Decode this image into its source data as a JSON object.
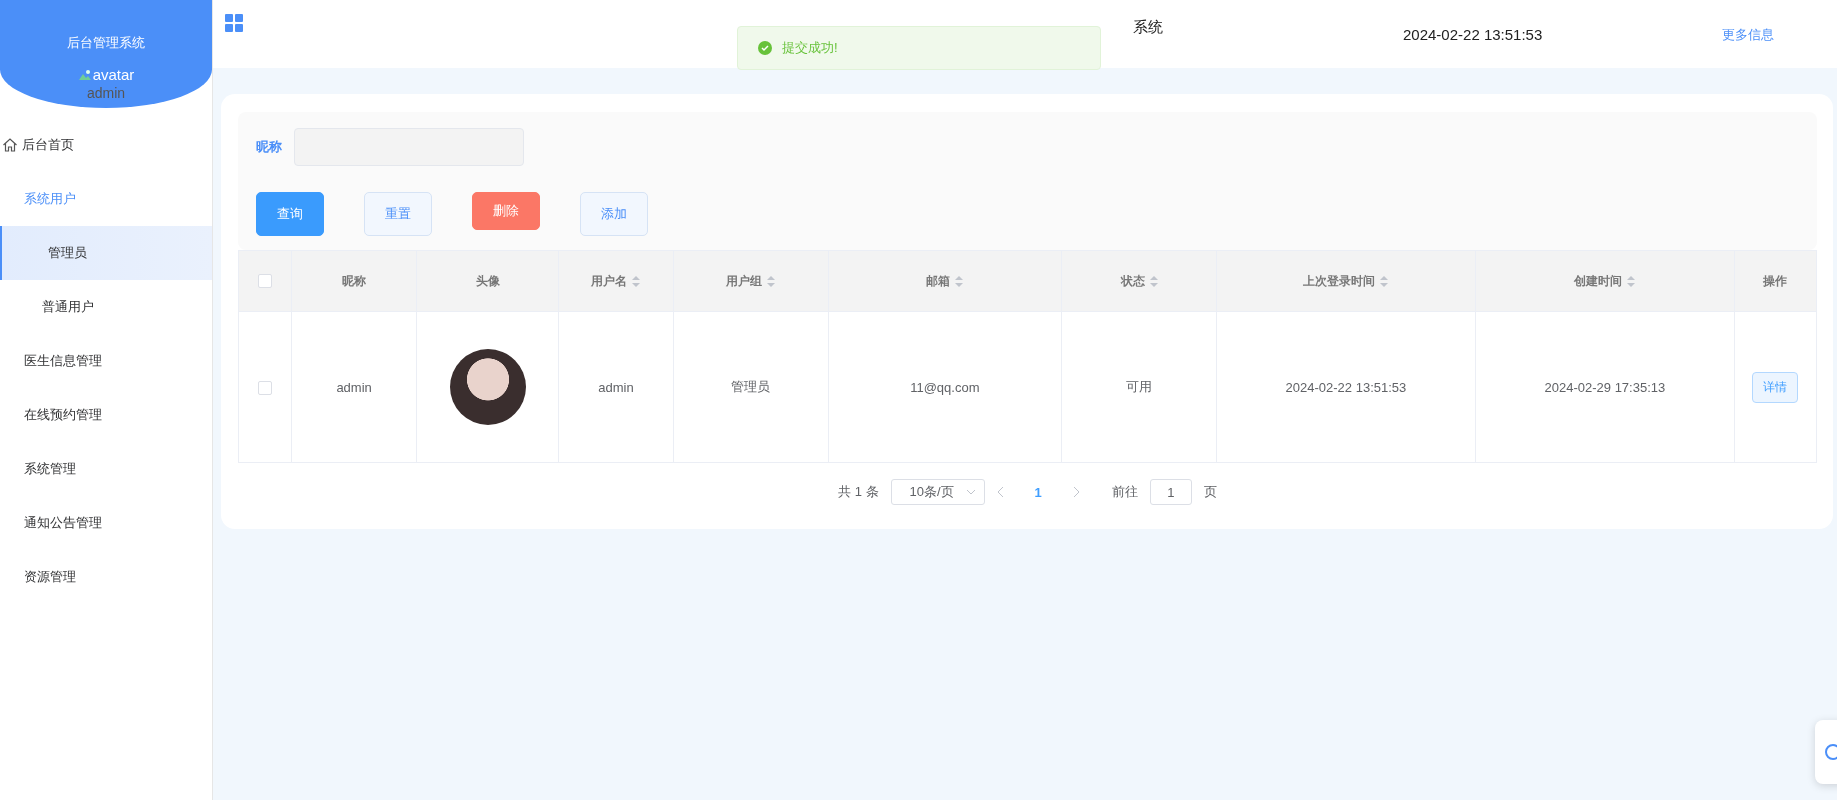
{
  "sidebar": {
    "title": "后台管理系统",
    "avatar_alt": "avatar",
    "username": "admin",
    "items": [
      {
        "label": "后台首页",
        "kind": "home",
        "selected": false
      },
      {
        "label": "系统用户",
        "kind": "group",
        "expanded": true,
        "children": [
          {
            "label": "管理员",
            "selected": true
          },
          {
            "label": "普通用户",
            "selected": false
          }
        ]
      },
      {
        "label": "医生信息管理",
        "kind": "plain",
        "selected": false
      },
      {
        "label": "在线预约管理",
        "kind": "plain",
        "selected": false
      },
      {
        "label": "系统管理",
        "kind": "plain",
        "selected": false
      },
      {
        "label": "通知公告管理",
        "kind": "plain",
        "selected": false
      },
      {
        "label": "资源管理",
        "kind": "plain",
        "selected": false
      }
    ]
  },
  "header": {
    "title": "系统",
    "datetime": "2024-02-22 13:51:53",
    "more_link": "更多信息"
  },
  "toast": {
    "message": "提交成功!"
  },
  "filter": {
    "label": "昵称",
    "buttons": [
      {
        "label": "查询",
        "kind": "primary"
      },
      {
        "label": "重置",
        "kind": "plain"
      },
      {
        "label": "删除",
        "kind": "danger"
      },
      {
        "label": "添加",
        "kind": "plain"
      }
    ]
  },
  "table": {
    "select_all_checked": false,
    "columns": [
      {
        "kind": "check"
      },
      {
        "label": "昵称",
        "kind": "text",
        "sortable": false
      },
      {
        "label": "头像",
        "kind": "avatar",
        "sortable": false
      },
      {
        "label": "用户名",
        "kind": "text",
        "sortable": true
      },
      {
        "label": "用户组",
        "kind": "text",
        "sortable": true
      },
      {
        "label": "邮箱",
        "kind": "text",
        "sortable": true
      },
      {
        "label": "状态",
        "kind": "text",
        "sortable": true
      },
      {
        "label": "上次登录时间",
        "kind": "text",
        "sortable": true
      },
      {
        "label": "创建时间",
        "kind": "text",
        "sortable": true
      },
      {
        "label": "操作",
        "kind": "action",
        "sortable": false
      }
    ],
    "rows": [
      {
        "checked": false,
        "cells": [
          "",
          "admin",
          "",
          "admin",
          "管理员",
          "11@qq.com",
          "可用",
          "2024-02-22 13:51:53",
          "2024-02-29 17:35:13",
          "详情"
        ]
      }
    ]
  },
  "pagination": {
    "total": "共 1 条",
    "page_size": "10条/页",
    "pages": [
      {
        "label": "1",
        "selected": true
      }
    ],
    "goto_label": "前往",
    "goto_value": "1",
    "page_suffix": "页"
  }
}
